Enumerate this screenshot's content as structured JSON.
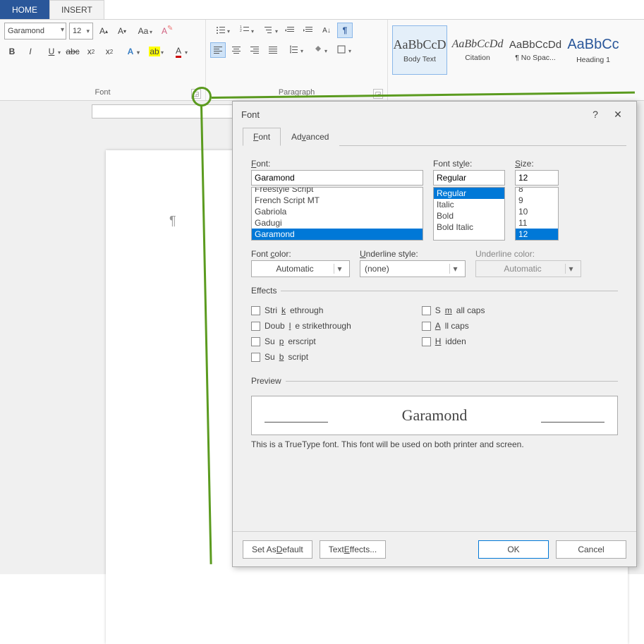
{
  "tabs": {
    "home": "HOME",
    "insert": "INSERT"
  },
  "ribbon": {
    "font_name": "Garamond",
    "font_size": "12",
    "group_font": "Font",
    "group_paragraph": "Paragraph",
    "styles": [
      {
        "sample": "AaBbCcD",
        "name": "Body Text",
        "css": "font-family:Georgia,serif"
      },
      {
        "sample": "AaBbCcDd",
        "name": "Citation",
        "css": "font-style:italic;font-family:Georgia,serif;font-size:16px"
      },
      {
        "sample": "AaBbCcDd",
        "name": "¶ No Spac...",
        "css": "font-size:15px"
      },
      {
        "sample": "AaBbCc",
        "name": "Heading 1",
        "css": "color:#2a579a;font-size:20px"
      }
    ]
  },
  "dialog": {
    "title": "Font",
    "tab_font": "Font",
    "tab_advanced": "Advanced",
    "font_label": "Font:",
    "font_value": "Garamond",
    "font_list": [
      "Freestyle Script",
      "French Script MT",
      "Gabriola",
      "Gadugi",
      "Garamond"
    ],
    "font_selected": "Garamond",
    "style_label": "Font style:",
    "style_value": "Regular",
    "style_list": [
      "Regular",
      "Italic",
      "Bold",
      "Bold Italic"
    ],
    "style_selected": "Regular",
    "size_label": "Size:",
    "size_value": "12",
    "size_list": [
      "8",
      "9",
      "10",
      "11",
      "12"
    ],
    "size_selected": "12",
    "color_label": "Font color:",
    "color_value": "Automatic",
    "uline_label": "Underline style:",
    "uline_value": "(none)",
    "ucolor_label": "Underline color:",
    "ucolor_value": "Automatic",
    "effects_label": "Effects",
    "eff_strike": "Strikethrough",
    "eff_dstrike": "Double strikethrough",
    "eff_super": "Superscript",
    "eff_sub": "Subscript",
    "eff_smallcaps": "Small caps",
    "eff_allcaps": "All caps",
    "eff_hidden": "Hidden",
    "preview_label": "Preview",
    "preview_text": "Garamond",
    "note": "This is a TrueType font. This font will be used on both printer and screen.",
    "btn_default": "Set As Default",
    "btn_texteffects": "Text Effects...",
    "btn_ok": "OK",
    "btn_cancel": "Cancel"
  }
}
